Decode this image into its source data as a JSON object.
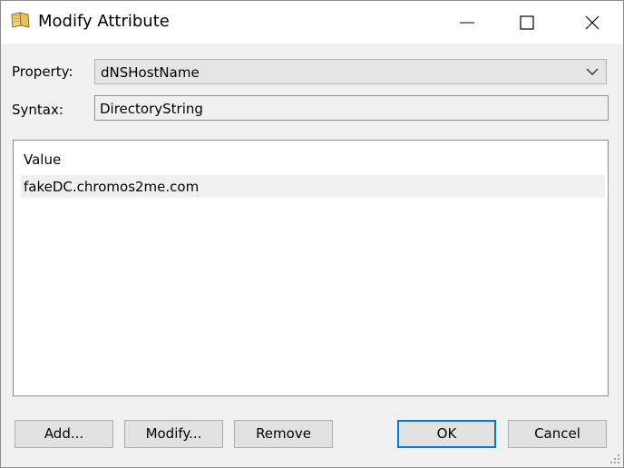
{
  "window": {
    "title": "Modify Attribute",
    "icon": "book-icon",
    "controls": {
      "minimize": "minimize-icon",
      "maximize": "maximize-icon",
      "close": "close-icon"
    }
  },
  "property": {
    "label": "Property:",
    "value": "dNSHostName"
  },
  "syntax": {
    "label": "Syntax:",
    "value": "DirectoryString"
  },
  "values_list": {
    "column_header": "Value",
    "rows": [
      "fakeDC.chromos2me.com"
    ]
  },
  "buttons": {
    "add": "Add...",
    "modify": "Modify...",
    "remove": "Remove",
    "ok": "OK",
    "cancel": "Cancel"
  },
  "colors": {
    "default_button_border": "#0078d7",
    "dialog_background": "#f0f0f0"
  }
}
